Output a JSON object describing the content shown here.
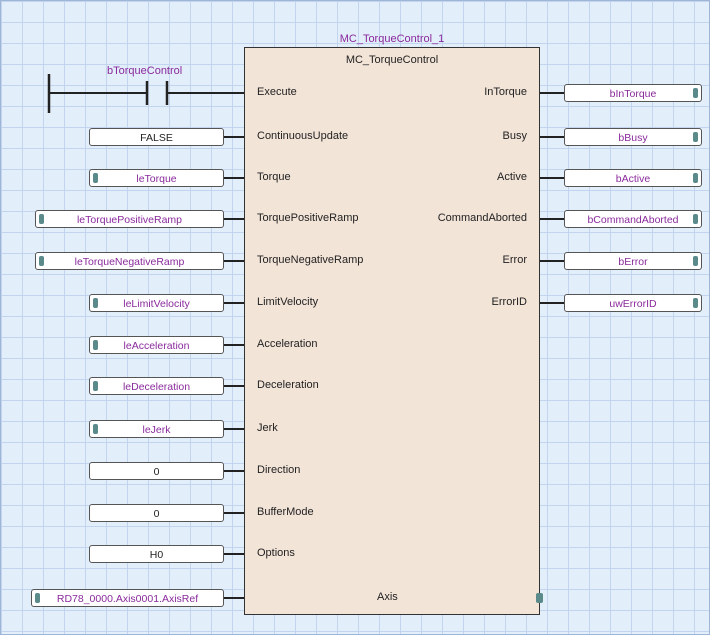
{
  "fb": {
    "instance_name": "MC_TorqueControl_1",
    "type_name": "MC_TorqueControl"
  },
  "contact": {
    "label": "bTorqueControl"
  },
  "inputs": [
    {
      "pin": "Execute",
      "variable": ""
    },
    {
      "pin": "ContinuousUpdate",
      "variable": "FALSE"
    },
    {
      "pin": "Torque",
      "variable": "leTorque"
    },
    {
      "pin": "TorquePositiveRamp",
      "variable": "leTorquePositiveRamp"
    },
    {
      "pin": "TorqueNegativeRamp",
      "variable": "leTorqueNegativeRamp"
    },
    {
      "pin": "LimitVelocity",
      "variable": "leLimitVelocity"
    },
    {
      "pin": "Acceleration",
      "variable": "leAcceleration"
    },
    {
      "pin": "Deceleration",
      "variable": "leDeceleration"
    },
    {
      "pin": "Jerk",
      "variable": "leJerk"
    },
    {
      "pin": "Direction",
      "variable": "0"
    },
    {
      "pin": "BufferMode",
      "variable": "0"
    },
    {
      "pin": "Options",
      "variable": "H0"
    }
  ],
  "outputs": [
    {
      "pin": "InTorque",
      "variable": "bInTorque"
    },
    {
      "pin": "Busy",
      "variable": "bBusy"
    },
    {
      "pin": "Active",
      "variable": "bActive"
    },
    {
      "pin": "CommandAborted",
      "variable": "bCommandAborted"
    },
    {
      "pin": "Error",
      "variable": "bError"
    },
    {
      "pin": "ErrorID",
      "variable": "uwErrorID"
    }
  ],
  "inout": {
    "pin": "Axis",
    "variable": "RD78_0000.Axis0001.AxisRef"
  },
  "colors": {
    "variable_text": "#8a2a9c",
    "block_fill": "#f3e4d8",
    "grid_background": "#e3eefb"
  }
}
